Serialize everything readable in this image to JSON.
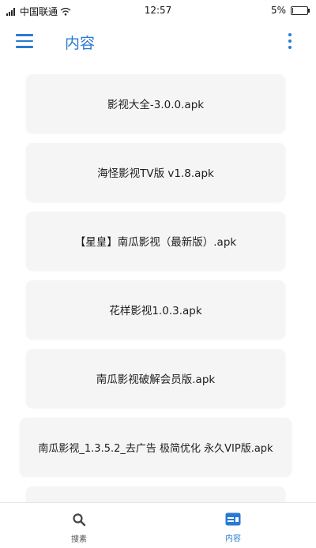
{
  "status_bar": {
    "carrier": "中国联通",
    "time": "12:57",
    "battery": "5%",
    "battery_level": 0.05
  },
  "app_bar": {
    "title": "内容",
    "menu_icon": "menu-icon",
    "more_icon": "more-vert-icon"
  },
  "files": [
    "影视大全-3.0.0.apk",
    "海怪影视TV版 v1.8.apk",
    "【星皇】南瓜影视（最新版）.apk",
    "花样影视1.0.3.apk",
    "南瓜影视破解会员版.apk",
    "南瓜影视_1.3.5.2_去广告 极简优化 永久VIP版.apk"
  ],
  "bottom_nav": {
    "search_label": "搜素",
    "content_label": "内容",
    "active": "content"
  },
  "colors": {
    "accent": "#2a7ad2",
    "card_bg": "#f5f5f5"
  }
}
